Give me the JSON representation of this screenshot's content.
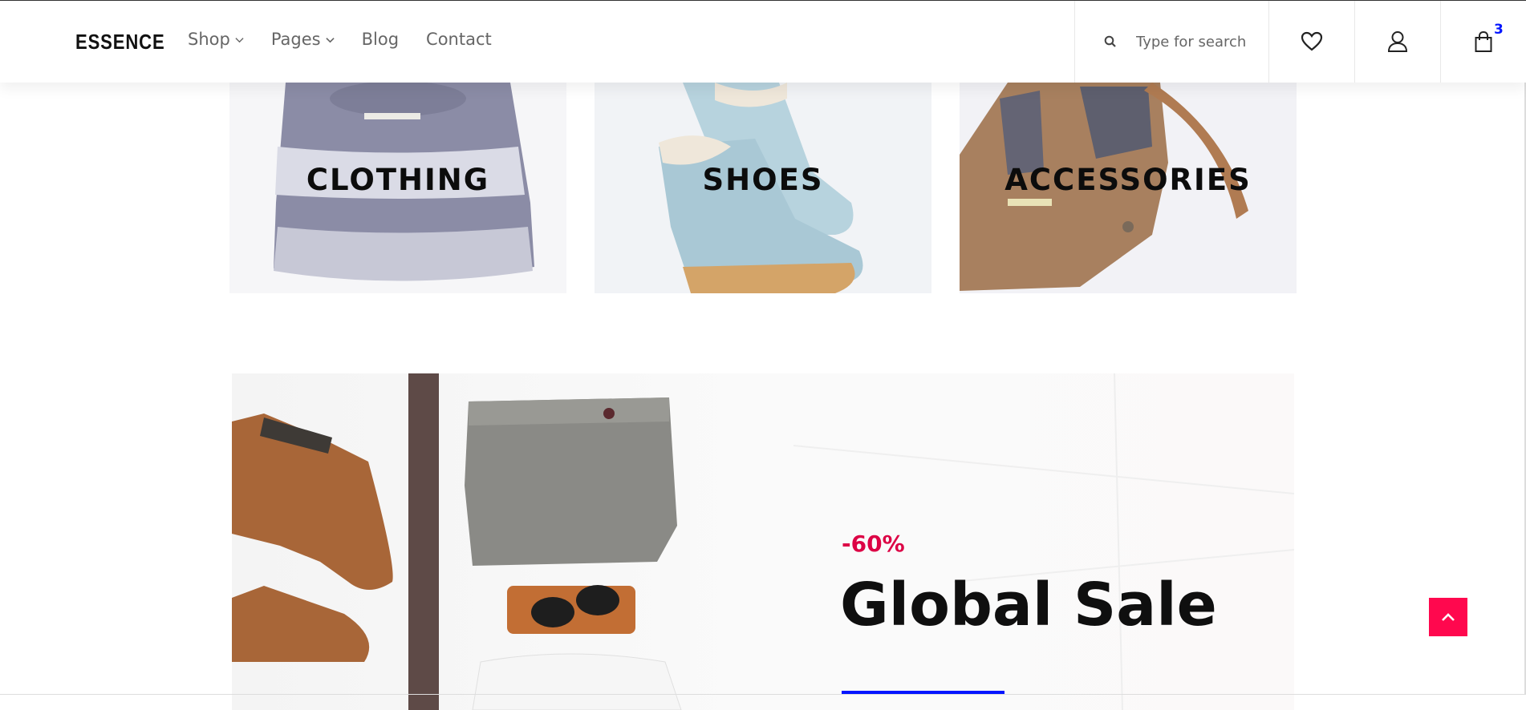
{
  "header": {
    "logo": "ESSENCE",
    "nav": [
      {
        "label": "Shop",
        "has_dropdown": true
      },
      {
        "label": "Pages",
        "has_dropdown": true
      },
      {
        "label": "Blog",
        "has_dropdown": false
      },
      {
        "label": "Contact",
        "has_dropdown": false
      }
    ],
    "search_placeholder": "Type for search",
    "cart_count": "3"
  },
  "categories": [
    {
      "label": "CLOTHING"
    },
    {
      "label": "SHOES"
    },
    {
      "label": "ACCESSORIES"
    }
  ],
  "banner": {
    "discount": "-60%",
    "title": "Global Sale"
  },
  "colors": {
    "accent": "#ff084e",
    "discount": "#dc0345",
    "cart_count": "#0315ff",
    "underline": "#0315ff"
  },
  "icons": [
    "chevron-down-icon",
    "search-icon",
    "heart-icon",
    "user-icon",
    "shopping-bag-icon",
    "arrow-up-icon"
  ]
}
